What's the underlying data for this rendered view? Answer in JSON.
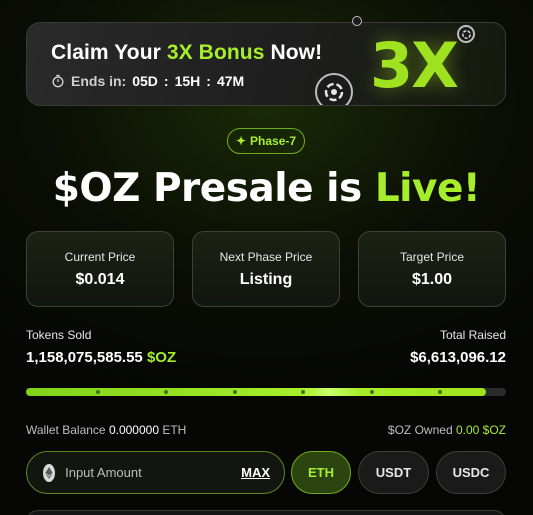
{
  "bonus": {
    "title_pre": "Claim Your ",
    "title_accent": "3X Bonus",
    "title_post": " Now!",
    "timer_label": "Ends in:",
    "days": "05D",
    "hours": "15H",
    "minutes": "47M",
    "sep": ":",
    "badge": "3X"
  },
  "phase": {
    "label": "Phase-7"
  },
  "headline": {
    "main": "$OZ Presale is ",
    "accent": "Live!"
  },
  "prices": [
    {
      "title": "Current Price",
      "value": "$0.014"
    },
    {
      "title": "Next Phase Price",
      "value": "Listing"
    },
    {
      "title": "Target Price",
      "value": "$1.00"
    }
  ],
  "stats": {
    "sold_label": "Tokens Sold",
    "sold_value": "1,158,075,585.55",
    "sold_currency": "$OZ",
    "raised_label": "Total Raised",
    "raised_value": "$6,613,096.12"
  },
  "progress": {
    "fraction": 0.958
  },
  "wallet": {
    "balance_label": "Wallet Balance",
    "balance_value": "0.000000",
    "balance_unit": "ETH",
    "owned_label": "$OZ Owned",
    "owned_value": "0.00 $OZ"
  },
  "input": {
    "placeholder": "Input Amount",
    "max_label": "MAX"
  },
  "tokens": [
    "ETH",
    "USDT",
    "USDC"
  ],
  "colors": {
    "accent": "#a6ee2b",
    "background": "#0b0e05"
  }
}
